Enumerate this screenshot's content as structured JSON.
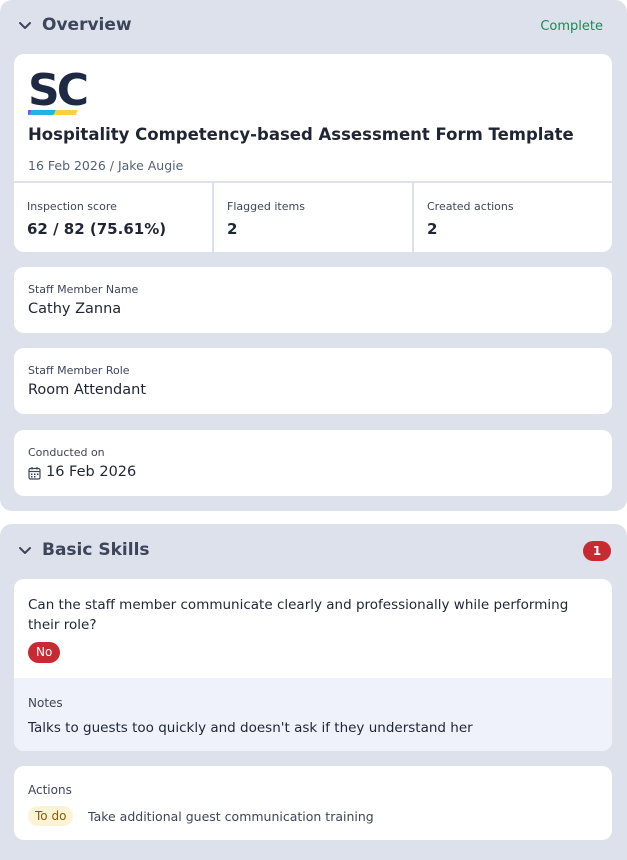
{
  "overview": {
    "title": "Overview",
    "status": "Complete",
    "logo_text": "SC",
    "template_title": "Hospitality Competency-based Assessment Form Template",
    "meta": "16 Feb 2026 / Jake Augie",
    "stats": [
      {
        "label": "Inspection score",
        "value": "62 / 82 (75.61%)"
      },
      {
        "label": "Flagged items",
        "value": "2"
      },
      {
        "label": "Created actions",
        "value": "2"
      }
    ],
    "fields": {
      "name": {
        "label": "Staff Member Name",
        "value": "Cathy Zanna"
      },
      "role": {
        "label": "Staff Member Role",
        "value": "Room Attendant"
      },
      "conducted": {
        "label": "Conducted on",
        "value": "16 Feb 2026"
      }
    }
  },
  "basic_skills": {
    "title": "Basic Skills",
    "flag_count": "1",
    "question": "Can the staff member communicate clearly and professionally while performing their role?",
    "answer": "No",
    "notes_label": "Notes",
    "notes_text": "Talks to guests too quickly and doesn't ask if they understand her",
    "actions_label": "Actions",
    "action_status": "To do",
    "action_text": "Take additional guest communication training"
  },
  "colors": {
    "section_bg": "#dde1ec",
    "complete": "#1a8a55",
    "flag_red": "#c72a33",
    "todo_bg": "#fff3d6",
    "todo_text": "#8a5a00"
  },
  "icons": [
    "chevron-down-icon",
    "calendar-icon"
  ]
}
